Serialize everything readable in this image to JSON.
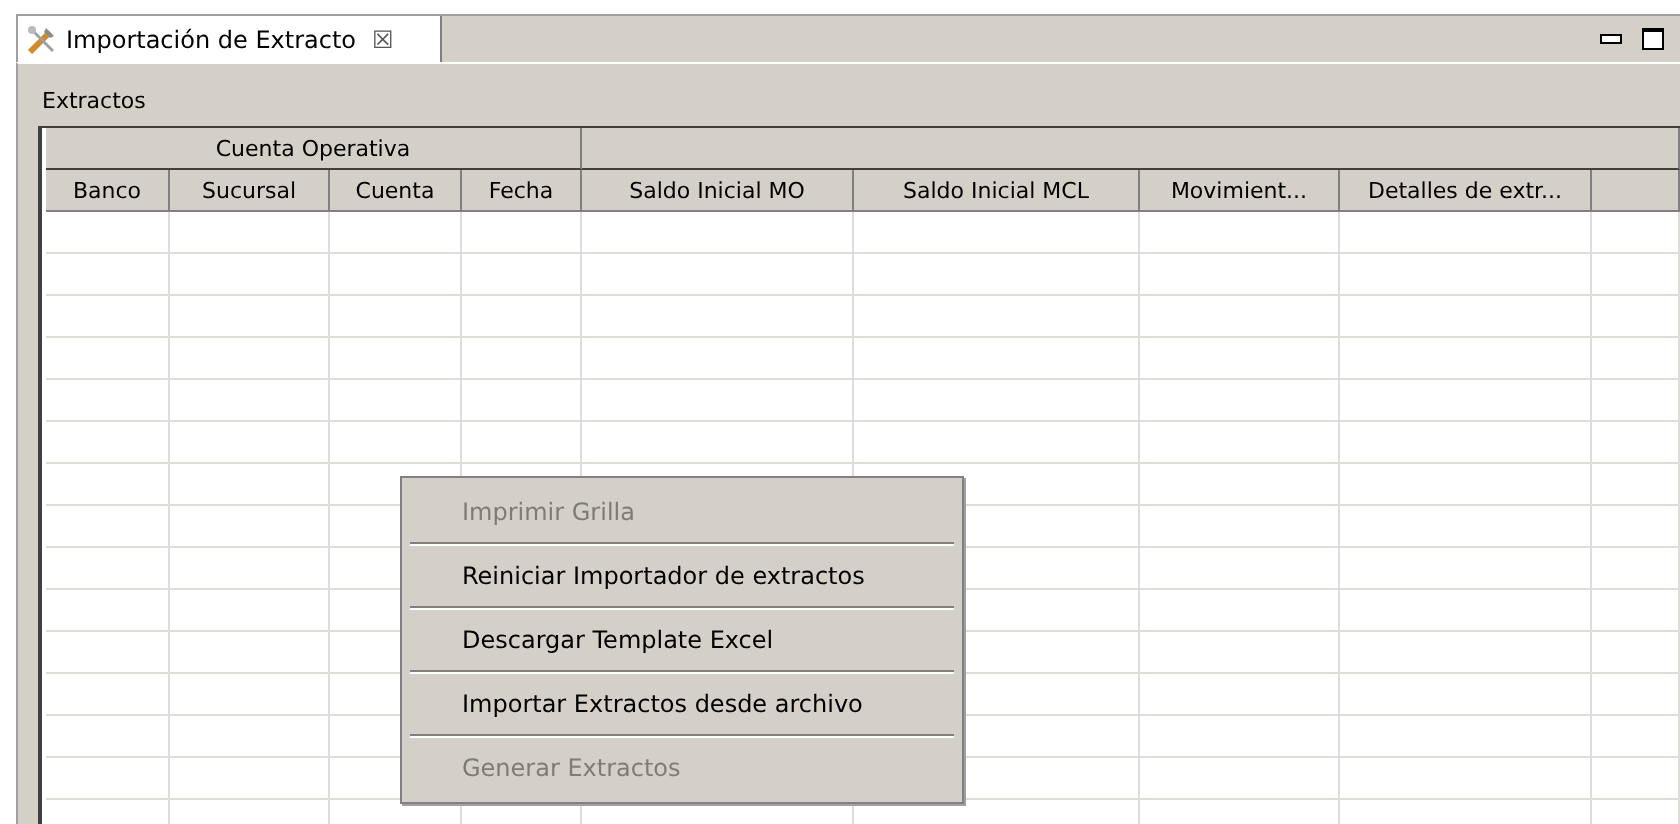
{
  "tab": {
    "title": "Importación de Extracto",
    "close": "☒"
  },
  "section_label": "Extractos",
  "table": {
    "column_groups": [
      {
        "label": "Cuenta Operativa"
      }
    ],
    "columns": [
      "Banco",
      "Sucursal",
      "Cuenta",
      "Fecha",
      "Saldo Inicial MO",
      "Saldo Inicial MCL",
      "Movimient...",
      "Detalles de extr..."
    ]
  },
  "context_menu": {
    "items": [
      {
        "label": "Imprimir Grilla",
        "disabled": true
      },
      {
        "label": "Reiniciar Importador de extractos",
        "disabled": false
      },
      {
        "label": "Descargar Template Excel",
        "disabled": false
      },
      {
        "label": "Importar Extractos desde archivo",
        "disabled": false
      },
      {
        "label": "Generar Extractos",
        "disabled": true
      }
    ]
  }
}
